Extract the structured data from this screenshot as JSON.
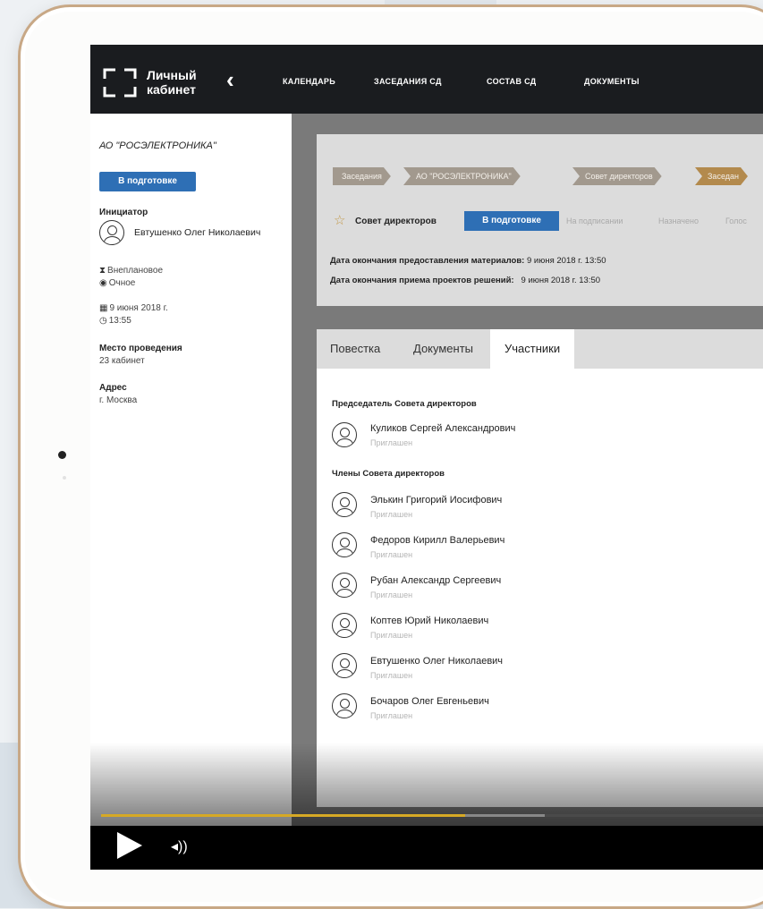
{
  "topbar": {
    "logo_line1": "Личный",
    "logo_line2": "кабинет",
    "back_icon": "chevron-left-icon",
    "nav": [
      "КАЛЕНДАРЬ",
      "ЗАСЕДАНИЯ СД",
      "СОСТАВ СД",
      "ДОКУМЕНТЫ"
    ]
  },
  "sidebar": {
    "org": "АО \"РОСЭЛЕКТРОНИКА\"",
    "status": "В подготовке",
    "initiator_label": "Инициатор",
    "initiator_name": "Евтушенко Олег Николаевич",
    "meeting_kind": "Внеплановое",
    "meeting_form": "Очное",
    "date": "9 июня 2018 г.",
    "time": "13:55",
    "place_label": "Место проведения",
    "place": "23 кабинет",
    "address_label": "Адрес",
    "address": "г. Москва"
  },
  "breadcrumbs": [
    "Заседания",
    "АО \"РОСЭЛЕКТРОНИКА\"",
    "Совет директоров",
    "Заседан"
  ],
  "board": {
    "label": "Совет директоров",
    "steps": [
      "В подготовке",
      "На подписании",
      "Назначено",
      "Голос"
    ],
    "active_step": 0,
    "materials_label": "Дата окончания предоставления материалов:",
    "materials_date": "9 июня 2018 г. 13:50",
    "drafts_label": "Дата окончания приема проектов решений:",
    "drafts_date": "9 июня 2018 г. 13:50"
  },
  "tabs": [
    "Повестка",
    "Документы",
    "Участники"
  ],
  "active_tab": 2,
  "participants": {
    "chair_label": "Председатель Совета директоров",
    "chair": {
      "name": "Куликов Сергей Александрович",
      "status": "Приглашен"
    },
    "members_label": "Члены Совета директоров",
    "members": [
      {
        "name": "Элькин Григорий Иосифович",
        "status": "Приглашен"
      },
      {
        "name": "Федоров Кирилл Валерьевич",
        "status": "Приглашен"
      },
      {
        "name": "Рубан Александр Сергеевич",
        "status": "Приглашен"
      },
      {
        "name": "Коптев Юрий Николаевич",
        "status": "Приглашен"
      },
      {
        "name": "Евтушенко Олег Николаевич",
        "status": "Приглашен"
      },
      {
        "name": "Бочаров Олег Евгеньевич",
        "status": "Приглашен"
      }
    ]
  },
  "player": {
    "progress": 0.55,
    "buffered": 0.67,
    "play_icon": "play-icon",
    "volume_icon": "volume-icon"
  },
  "colors": {
    "accent_blue": "#2e6fb5",
    "gold": "#b38a4d",
    "progress": "#d6a925",
    "topbar": "#1a1c1f"
  }
}
